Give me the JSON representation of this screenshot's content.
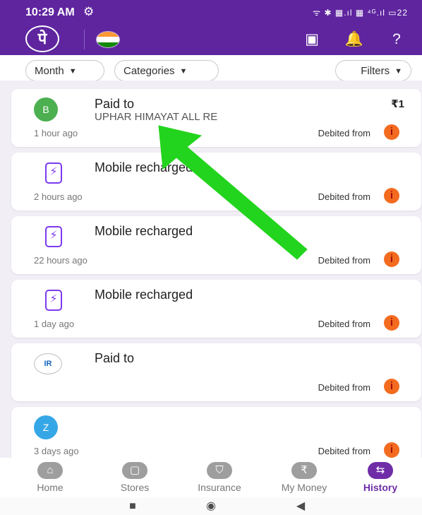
{
  "status_bar": {
    "time": "10:29 AM",
    "right_icons": "ᯤ ✱ ▦.ıl ▦ ⁴ᴳ.ıl ▭22"
  },
  "app_bar": {
    "logo_text": "पे",
    "flag_name": "india-flag",
    "qr_label": "▣",
    "bell_label": "🔔",
    "help_label": "?"
  },
  "filters": {
    "month_label": "Month",
    "categories_label": "Categories",
    "filters_label": "Filters"
  },
  "transactions": [
    {
      "avatar_letter": "B",
      "title": "Paid to",
      "subtitle": "UPHAR HIMAYAT ALL RE",
      "amount": "₹1",
      "time": "1 hour ago",
      "debited": "Debited from"
    },
    {
      "title": "Mobile recharged",
      "time": "2 hours ago",
      "debited": "Debited from"
    },
    {
      "title": "Mobile recharged",
      "time": "22 hours ago",
      "debited": "Debited from"
    },
    {
      "title": "Mobile recharged",
      "time": "1 day ago",
      "debited": "Debited from"
    },
    {
      "title": "Paid to",
      "time": "",
      "debited": "Debited from"
    },
    {
      "avatar_letter": "Z",
      "title": "",
      "time": "3 days ago",
      "debited": "Debited from"
    }
  ],
  "bottom_nav": [
    {
      "label": "Home"
    },
    {
      "label": "Stores"
    },
    {
      "label": "Insurance"
    },
    {
      "label": "My Money"
    },
    {
      "label": "History"
    }
  ],
  "android_nav": {
    "recent_label": "■",
    "home_label": "◉",
    "back_label": "◀"
  },
  "colors": {
    "brand_purple": "#5f259f",
    "active_nav": "#6f2da8",
    "arrow_green": "#22d41d"
  }
}
